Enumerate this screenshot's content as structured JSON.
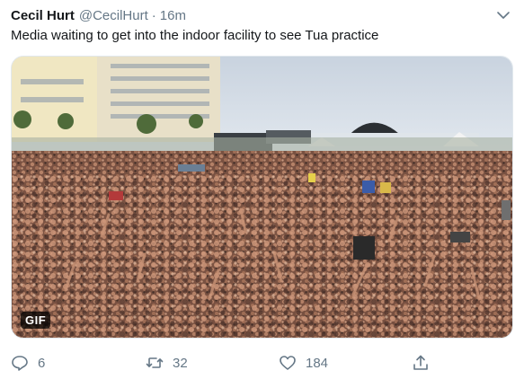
{
  "tweet": {
    "display_name": "Cecil Hurt",
    "handle": "@CecilHurt",
    "separator": "·",
    "time": "16m",
    "text": "Media waiting to get into the indoor facility to see Tua practice",
    "media_badge": "GIF",
    "icons": {
      "menu": "chevron-down-icon",
      "reply": "reply-icon",
      "retweet": "retweet-icon",
      "like": "heart-icon",
      "share": "share-icon"
    }
  },
  "actions": {
    "replies": "6",
    "retweets": "32",
    "likes": "184"
  },
  "colors": {
    "text_primary": "#14171a",
    "text_secondary": "#657786"
  }
}
